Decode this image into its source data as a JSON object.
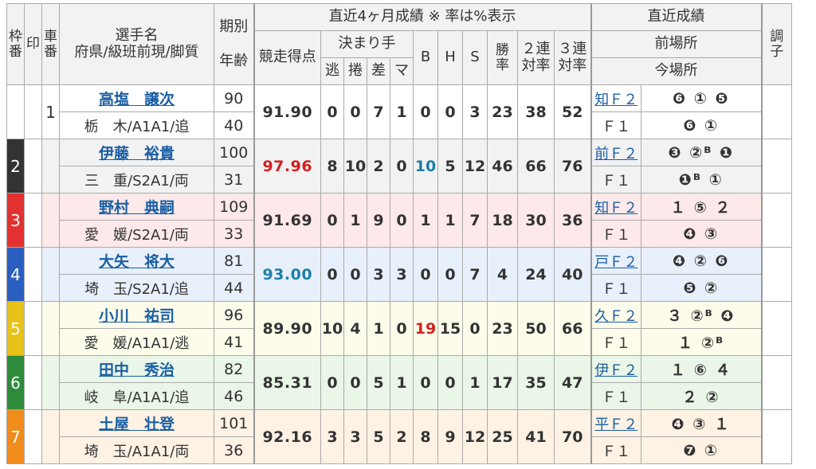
{
  "headers": {
    "waku": [
      "枠",
      "番"
    ],
    "mark": "印",
    "car": [
      "車",
      "番"
    ],
    "name_top": "選手名",
    "name_bottom": "府県/級班前現/脚質",
    "term_top": "期別",
    "term_bottom": "年齢",
    "recent_title": "直近4ヶ月成績 ※ 率は%表示",
    "score": "競走得点",
    "kimarite": "決まり手",
    "k_nige": "逃",
    "k_makuri": "捲",
    "k_sashi": "差",
    "k_mark": "マ",
    "b": "B",
    "h": "H",
    "s": "S",
    "win_rate": [
      "勝",
      "率"
    ],
    "ren2": [
      "２連",
      "対率"
    ],
    "ren3": [
      "３連",
      "対率"
    ],
    "latest_title": "直近成績",
    "prev_venue": "前場所",
    "cur_venue": "今場所",
    "condition": [
      "調",
      "子"
    ]
  },
  "riders": [
    {
      "waku": "",
      "car": "1",
      "name": "高塩　譲次",
      "pref": "栃　木/A1A1/追",
      "term": "90",
      "age": "40",
      "score": "91.90",
      "nige": "0",
      "makuri": "0",
      "sashi": "7",
      "mark": "1",
      "b": "0",
      "h": "0",
      "s": "3",
      "win": "23",
      "r2": "38",
      "r3": "52",
      "prev_place": "知Ｆ２",
      "prev_results": "❻ ① ❺",
      "cur_place": "Ｆ１",
      "cur_results": "❻ ①",
      "bg": "#ffffff",
      "waku_color": "#ffffff"
    },
    {
      "waku": "2",
      "car": "",
      "name": "伊藤　裕貴",
      "pref": "三　重/S2A1/両",
      "term": "100",
      "age": "31",
      "score": "97.96",
      "nige": "8",
      "makuri": "10",
      "sashi": "2",
      "mark": "0",
      "b": "10",
      "h": "5",
      "s": "12",
      "win": "46",
      "r2": "66",
      "r3": "76",
      "prev_place": "前Ｆ２",
      "prev_results": "❸ ②ᴮ ❶",
      "cur_place": "Ｆ１",
      "cur_results": "❶ᴮ ①",
      "bg": "#f2f2f2",
      "waku_color": "#333333"
    },
    {
      "waku": "3",
      "car": "",
      "name": "野村　典嗣",
      "pref": "愛　媛/S2A1/両",
      "term": "109",
      "age": "33",
      "score": "91.69",
      "nige": "0",
      "makuri": "1",
      "sashi": "9",
      "mark": "0",
      "b": "1",
      "h": "1",
      "s": "7",
      "win": "18",
      "r2": "30",
      "r3": "36",
      "prev_place": "知Ｆ２",
      "prev_results": "１ ⑤ ２",
      "cur_place": "Ｆ１",
      "cur_results": "❹ ③",
      "bg": "#fde9e9",
      "waku_color": "#e33030"
    },
    {
      "waku": "4",
      "car": "",
      "name": "大矢　将大",
      "pref": "埼　玉/S2A1/追",
      "term": "81",
      "age": "44",
      "score": "93.00",
      "nige": "0",
      "makuri": "0",
      "sashi": "3",
      "mark": "3",
      "b": "0",
      "h": "0",
      "s": "7",
      "win": "4",
      "r2": "24",
      "r3": "40",
      "prev_place": "戸Ｆ２",
      "prev_results": "❹ ② ❻",
      "cur_place": "Ｆ１",
      "cur_results": "❺ ②",
      "bg": "#e8f0fc",
      "waku_color": "#2a5fbf"
    },
    {
      "waku": "5",
      "car": "",
      "name": "小川　祐司",
      "pref": "愛　媛/A1A1/逃",
      "term": "96",
      "age": "41",
      "score": "89.90",
      "nige": "10",
      "makuri": "4",
      "sashi": "1",
      "mark": "0",
      "b": "19",
      "h": "15",
      "s": "0",
      "win": "23",
      "r2": "50",
      "r3": "66",
      "prev_place": "久Ｆ２",
      "prev_results": "３ ②ᴮ ❹",
      "cur_place": "Ｆ１",
      "cur_results": "１ ②ᴮ",
      "bg": "#fdfbea",
      "waku_color": "#e8c21a"
    },
    {
      "waku": "6",
      "car": "",
      "name": "田中　秀治",
      "pref": "岐　阜/A1A1/追",
      "term": "82",
      "age": "46",
      "score": "85.31",
      "nige": "0",
      "makuri": "0",
      "sashi": "5",
      "mark": "1",
      "b": "0",
      "h": "0",
      "s": "1",
      "win": "17",
      "r2": "35",
      "r3": "47",
      "prev_place": "伊Ｆ２",
      "prev_results": "１ ⑥ ４",
      "cur_place": "Ｆ１",
      "cur_results": "２ ②",
      "bg": "#eaf6e8",
      "waku_color": "#2e8b3a"
    },
    {
      "waku": "7",
      "car": "",
      "name": "土屋　壮登",
      "pref": "埼　玉/A1A1/両",
      "term": "101",
      "age": "36",
      "score": "92.16",
      "nige": "3",
      "makuri": "3",
      "sashi": "5",
      "mark": "2",
      "b": "8",
      "h": "9",
      "s": "12",
      "win": "25",
      "r2": "41",
      "r3": "70",
      "prev_place": "平Ｆ２",
      "prev_results": "❹ ③ １",
      "cur_place": "Ｆ１",
      "cur_results": "❼ ①",
      "bg": "#fdf2e4",
      "waku_color": "#f08c1a"
    }
  ]
}
